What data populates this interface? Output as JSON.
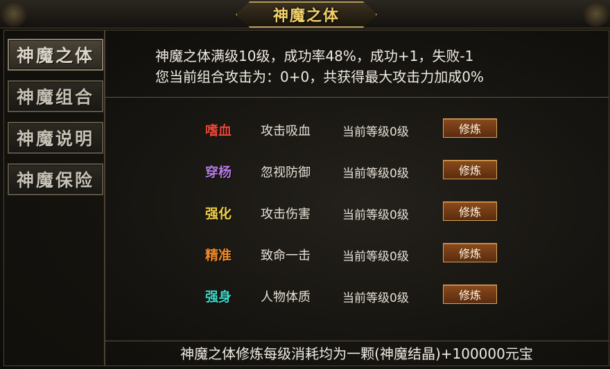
{
  "window": {
    "title": "神魔之体"
  },
  "nav": [
    {
      "label": "神魔之体",
      "active": true
    },
    {
      "label": "神魔组合",
      "active": false
    },
    {
      "label": "神魔说明",
      "active": false
    },
    {
      "label": "神魔保险",
      "active": false
    }
  ],
  "info": {
    "line1": "神魔之体满级10级，成功率48%，成功+1，失败-1",
    "line2": "您当前组合攻击为：0+0，共获得最大攻击力加成0%"
  },
  "skills": [
    {
      "name": "嗜血",
      "color": "#e8483a",
      "desc": "攻击吸血",
      "level": "当前等级0级",
      "button": "修炼"
    },
    {
      "name": "穿杨",
      "color": "#b47ae0",
      "desc": "忽视防御",
      "level": "当前等级0级",
      "button": "修炼"
    },
    {
      "name": "强化",
      "color": "#f2d24a",
      "desc": "攻击伤害",
      "level": "当前等级0级",
      "button": "修炼"
    },
    {
      "name": "精准",
      "color": "#f08a2a",
      "desc": "致命一击",
      "level": "当前等级0级",
      "button": "修炼"
    },
    {
      "name": "强身",
      "color": "#3ed8c8",
      "desc": "人物体质",
      "level": "当前等级0级",
      "button": "修炼"
    }
  ],
  "footer": {
    "text": "神魔之体修炼每级消耗均为一颗(神魔结晶)+100000元宝"
  }
}
